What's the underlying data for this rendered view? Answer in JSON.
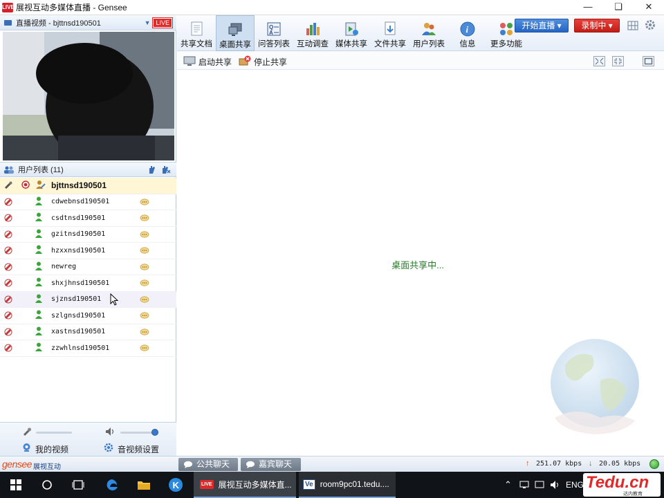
{
  "window": {
    "title": "展视互动多媒体直播 - Gensee",
    "app_badge": "LIVE"
  },
  "video_panel": {
    "title": "直播视频 - bjttnsd190501",
    "live_badge": "LIVE"
  },
  "user_panel": {
    "title": "用户列表 (11)",
    "users": [
      {
        "name": "bjttnsd190501",
        "selected": true
      },
      {
        "name": "cdwebnsd190501"
      },
      {
        "name": "csdtnsd190501"
      },
      {
        "name": "gzitnsd190501"
      },
      {
        "name": "hzxxnsd190501"
      },
      {
        "name": "newreg"
      },
      {
        "name": "shxjhnsd190501"
      },
      {
        "name": "sjznsd190501",
        "hover": true
      },
      {
        "name": "szlgnsd190501"
      },
      {
        "name": "xastnsd190501"
      },
      {
        "name": "zzwhlnsd190501"
      }
    ]
  },
  "left_footer": {
    "my_video": "我的视频",
    "av_settings": "音视频设置"
  },
  "toolbar": {
    "items": [
      {
        "label": "共享文档",
        "icon": "document-icon"
      },
      {
        "label": "桌面共享",
        "icon": "desktop-share-icon",
        "active": true
      },
      {
        "label": "问答列表",
        "icon": "qa-icon"
      },
      {
        "label": "互动调查",
        "icon": "survey-icon"
      },
      {
        "label": "媒体共享",
        "icon": "media-icon"
      },
      {
        "label": "文件共享",
        "icon": "file-share-icon"
      },
      {
        "label": "用户列表",
        "icon": "users-icon"
      },
      {
        "label": "信息",
        "icon": "info-icon"
      },
      {
        "label": "更多功能",
        "icon": "more-icon"
      }
    ],
    "start_live": "开始直播",
    "recording": "录制中"
  },
  "subbar": {
    "start_share": "启动共享",
    "stop_share": "停止共享"
  },
  "main": {
    "status": "桌面共享中..."
  },
  "bottombar": {
    "logo_text": "gensee",
    "logo_cn": "展视互动",
    "public_chat": "公共聊天",
    "guest_chat": "嘉宾聊天",
    "upload": "251.07 kbps",
    "download": "20.05 kbps"
  },
  "taskbar": {
    "task1": "展视互动多媒体直...",
    "task2": "room9pc01.tedu....",
    "lang": "ENG",
    "watermark": "Tedu.cn",
    "watermark_sub": "达内教育"
  },
  "colors": {
    "accent_blue": "#2565c4",
    "record_red": "#c31d17",
    "status_green": "#2a7a2a"
  }
}
